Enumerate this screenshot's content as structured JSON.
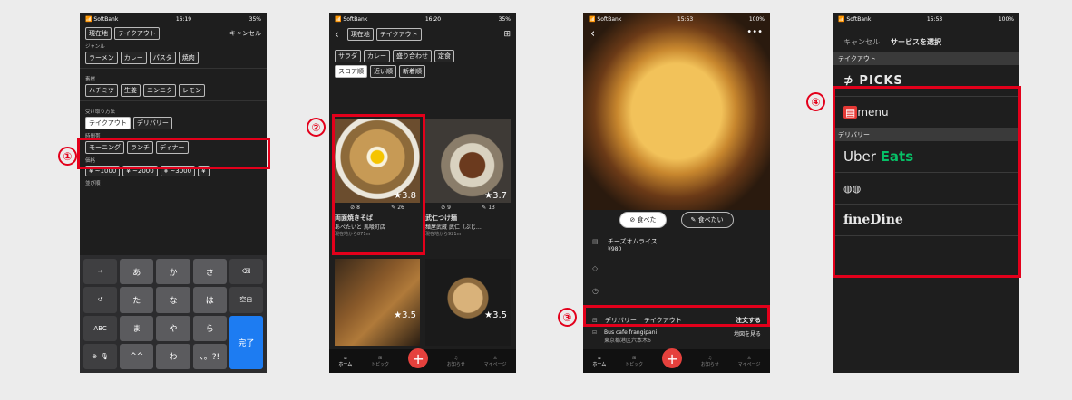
{
  "markers": [
    "①",
    "②",
    "③",
    "④"
  ],
  "status": {
    "s1_carrier": "SoftBank",
    "s1_time": "16:19",
    "s1_batt": "35%",
    "s2_time": "16:20",
    "s2_batt": "35%",
    "s3_time": "15:53",
    "s3_batt": "100%",
    "s4_time": "15:53",
    "s4_batt": "100%"
  },
  "s1": {
    "chip_location": "現在地",
    "chip_takeout": "テイクアウト",
    "cancel": "キャンセル",
    "genre_label": "ジャンル",
    "genres": [
      "ラーメン",
      "カレー",
      "パスタ",
      "焼肉"
    ],
    "ingredient_label": "素材",
    "ingredients": [
      "ハチミツ",
      "生姜",
      "ニンニク",
      "レモン"
    ],
    "method_label": "受け取り方法",
    "methods": [
      "テイクアウト",
      "デリバリー"
    ],
    "time_label": "時間帯",
    "times": [
      "モーニング",
      "ランチ",
      "ディナー"
    ],
    "price_label": "価格",
    "prices": [
      "¥ ~1000",
      "¥ ~2000",
      "¥ ~3000",
      "¥"
    ],
    "sort_label": "並び順",
    "keys": [
      "→",
      "あ",
      "か",
      "さ",
      "⌫",
      "↺",
      "た",
      "な",
      "は",
      "空白",
      "ABC",
      "ま",
      "や",
      "ら",
      "完了",
      "☺",
      "⊕",
      "^^",
      "わ",
      "、。?!"
    ]
  },
  "s2": {
    "chip_location": "現在地",
    "chip_takeout": "テイクアウト",
    "genres": [
      "サラダ",
      "カレー",
      "盛り合わせ",
      "定食"
    ],
    "sorts": [
      "スコア順",
      "近い順",
      "新着順"
    ],
    "card1": {
      "score": "3.8",
      "visited": "8",
      "want": "26",
      "name": "両面焼きそば",
      "shop": "あぺたいと 馬喰町店",
      "dist": "現在地から871m"
    },
    "card2": {
      "score": "3.7",
      "visited": "9",
      "want": "13",
      "name": "武仁つけ麺",
      "shop": "麺屋武蔵 武仁（ぶじ…",
      "dist": "現在地から921m"
    },
    "card3": {
      "score": "3.5"
    },
    "card4": {
      "score": "3.5"
    },
    "tabs": [
      "ホーム",
      "トピック",
      "",
      "お知らせ",
      "マイページ"
    ]
  },
  "s3": {
    "ate": "食べた",
    "want": "食べたい",
    "dish": "チーズオムライス",
    "price": "¥980",
    "delivery": "デリバリー",
    "takeout": "テイクアウト",
    "order": "注文する",
    "shop": "Bus cafe frangipani",
    "addr": "東京都港区六本木6",
    "map": "地図を見る",
    "tabs": [
      "ホーム",
      "トピック",
      "",
      "お知らせ",
      "マイページ"
    ]
  },
  "s4": {
    "cancel": "キャンセル",
    "title": "サービスを選択",
    "takeout_label": "テイクアウト",
    "picks": "PICKS",
    "menu": "menu",
    "delivery_label": "デリバリー",
    "uber1": "Uber",
    "uber2": "Eats",
    "finedine": "fineDine"
  },
  "colors": {
    "accent": "#e3001b",
    "uber_green": "#06c167",
    "menu_red": "#e53935"
  }
}
